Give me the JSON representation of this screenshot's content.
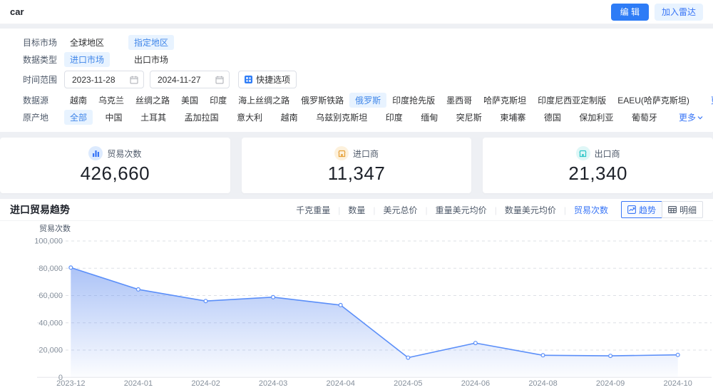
{
  "header": {
    "title": "car",
    "edit_button": "编 辑",
    "radar_button": "加入雷达"
  },
  "filters": {
    "target_market": {
      "label": "目标市场",
      "options": [
        {
          "text": "全球地区",
          "active": false
        },
        {
          "text": "指定地区",
          "active": true
        }
      ]
    },
    "data_type": {
      "label": "数据类型",
      "options": [
        {
          "text": "进口市场",
          "active": true
        },
        {
          "text": "出口市场",
          "active": false
        }
      ]
    },
    "time_range": {
      "label": "时间范围",
      "date_from": "2023-11-28",
      "date_to": "2024-11-27",
      "quick_button": "快捷选项"
    },
    "data_source": {
      "label": "数据源",
      "more": "更多",
      "options": [
        {
          "text": "越南",
          "active": false
        },
        {
          "text": "乌克兰",
          "active": false
        },
        {
          "text": "丝绸之路",
          "active": false
        },
        {
          "text": "美国",
          "active": false
        },
        {
          "text": "印度",
          "active": false
        },
        {
          "text": "海上丝绸之路",
          "active": false
        },
        {
          "text": "俄罗斯铁路",
          "active": false
        },
        {
          "text": "俄罗斯",
          "active": true
        },
        {
          "text": "印度抢先版",
          "active": false
        },
        {
          "text": "墨西哥",
          "active": false
        },
        {
          "text": "哈萨克斯坦",
          "active": false
        },
        {
          "text": "印度尼西亚定制版",
          "active": false
        },
        {
          "text": "EAEU(哈萨克斯坦)",
          "active": false
        }
      ]
    },
    "origin": {
      "label": "原产地",
      "more": "更多",
      "options": [
        {
          "text": "全部",
          "active": true
        },
        {
          "text": "中国",
          "active": false
        },
        {
          "text": "土耳其",
          "active": false
        },
        {
          "text": "孟加拉国",
          "active": false
        },
        {
          "text": "意大利",
          "active": false
        },
        {
          "text": "越南",
          "active": false
        },
        {
          "text": "乌兹别克斯坦",
          "active": false
        },
        {
          "text": "印度",
          "active": false
        },
        {
          "text": "缅甸",
          "active": false
        },
        {
          "text": "突尼斯",
          "active": false
        },
        {
          "text": "柬埔寨",
          "active": false
        },
        {
          "text": "德国",
          "active": false
        },
        {
          "text": "保加利亚",
          "active": false
        },
        {
          "text": "葡萄牙",
          "active": false
        }
      ]
    }
  },
  "stats": [
    {
      "label": "贸易次数",
      "value": "426,660",
      "icon": "bar-chart-icon",
      "color": "#3875f6",
      "bg": "#dceafe"
    },
    {
      "label": "进口商",
      "value": "11,347",
      "icon": "importer-icon",
      "color": "#e6a23c",
      "bg": "#fdf1dc"
    },
    {
      "label": "出口商",
      "value": "21,340",
      "icon": "exporter-icon",
      "color": "#2fc6c8",
      "bg": "#dff7f7"
    }
  ],
  "chart_header": {
    "title": "进口贸易趋势",
    "metrics": [
      "千克重量",
      "数量",
      "美元总价",
      "重量美元均价",
      "数量美元均价",
      "贸易次数"
    ],
    "active_metric": "贸易次数",
    "trend_button": "趋势",
    "detail_button": "明细"
  },
  "chart_data": {
    "type": "area",
    "x": [
      "2023-12",
      "2024-01",
      "2024-02",
      "2024-03",
      "2024-04",
      "2024-05",
      "2024-06",
      "2024-08",
      "2024-09",
      "2024-10"
    ],
    "values": [
      80500,
      64500,
      56000,
      58800,
      53000,
      14500,
      25200,
      16200,
      15800,
      16500
    ],
    "title": "进口贸易趋势",
    "xlabel": "",
    "ylabel": "贸易次数",
    "ylim": [
      0,
      100000
    ],
    "yticks": [
      0,
      20000,
      40000,
      60000,
      80000,
      100000
    ],
    "grid": true,
    "legend": "none",
    "line_color": "#5b8ff9",
    "point_fill": "#ffffff",
    "area_top_color": "rgba(104,146,240,0.55)",
    "area_bottom_color": "rgba(104,146,240,0.02)",
    "grid_color": "#dde0e6",
    "axis_color": "#e5e6eb",
    "tick_text_color": "#86909c"
  },
  "colors": {
    "accent": "#2e7cf6",
    "chip_bg": "#e8f3ff",
    "chip_text": "#4086e9",
    "page_bg": "#eef0f4"
  }
}
